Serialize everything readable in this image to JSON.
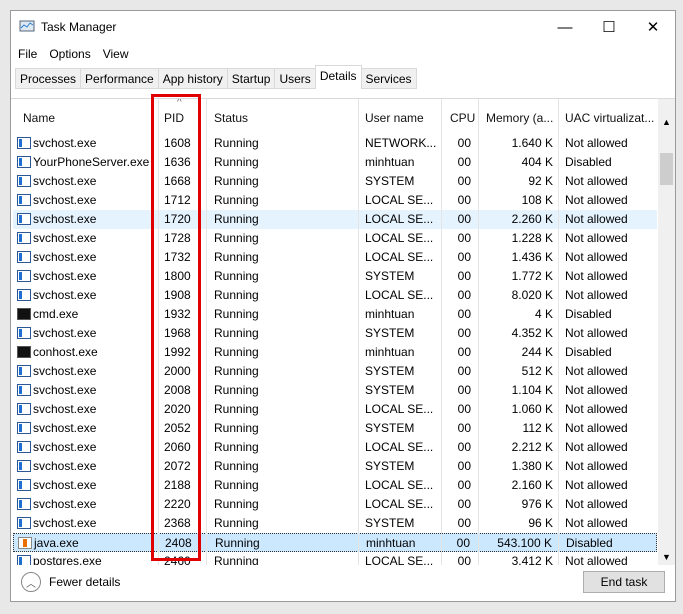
{
  "window": {
    "title": "Task Manager",
    "minimize": "—",
    "maximize": "☐",
    "close": "✕"
  },
  "menu": [
    "File",
    "Options",
    "View"
  ],
  "tabs": [
    "Processes",
    "Performance",
    "App history",
    "Startup",
    "Users",
    "Details",
    "Services"
  ],
  "active_tab": "Details",
  "columns": [
    "Name",
    "PID",
    "Status",
    "User name",
    "CPU",
    "Memory (a...",
    "UAC virtualizat..."
  ],
  "sort_indicator": "^",
  "rows": [
    [
      "svchost.exe",
      "1608",
      "Running",
      "NETWORK...",
      "00",
      "1.640 K",
      "Not allowed",
      "svc"
    ],
    [
      "YourPhoneServer.exe",
      "1636",
      "Running",
      "minhtuan",
      "00",
      "404 K",
      "Disabled",
      "svc"
    ],
    [
      "svchost.exe",
      "1668",
      "Running",
      "SYSTEM",
      "00",
      "92 K",
      "Not allowed",
      "svc"
    ],
    [
      "svchost.exe",
      "1712",
      "Running",
      "LOCAL SE...",
      "00",
      "108 K",
      "Not allowed",
      "svc"
    ],
    [
      "svchost.exe",
      "1720",
      "Running",
      "LOCAL SE...",
      "00",
      "2.260 K",
      "Not allowed",
      "svc"
    ],
    [
      "svchost.exe",
      "1728",
      "Running",
      "LOCAL SE...",
      "00",
      "1.228 K",
      "Not allowed",
      "svc"
    ],
    [
      "svchost.exe",
      "1732",
      "Running",
      "LOCAL SE...",
      "00",
      "1.436 K",
      "Not allowed",
      "svc"
    ],
    [
      "svchost.exe",
      "1800",
      "Running",
      "SYSTEM",
      "00",
      "1.772 K",
      "Not allowed",
      "svc"
    ],
    [
      "svchost.exe",
      "1908",
      "Running",
      "LOCAL SE...",
      "00",
      "8.020 K",
      "Not allowed",
      "svc"
    ],
    [
      "cmd.exe",
      "1932",
      "Running",
      "minhtuan",
      "00",
      "4 K",
      "Disabled",
      "cmd"
    ],
    [
      "svchost.exe",
      "1968",
      "Running",
      "SYSTEM",
      "00",
      "4.352 K",
      "Not allowed",
      "svc"
    ],
    [
      "conhost.exe",
      "1992",
      "Running",
      "minhtuan",
      "00",
      "244 K",
      "Disabled",
      "cmd"
    ],
    [
      "svchost.exe",
      "2000",
      "Running",
      "SYSTEM",
      "00",
      "512 K",
      "Not allowed",
      "svc"
    ],
    [
      "svchost.exe",
      "2008",
      "Running",
      "SYSTEM",
      "00",
      "1.104 K",
      "Not allowed",
      "svc"
    ],
    [
      "svchost.exe",
      "2020",
      "Running",
      "LOCAL SE...",
      "00",
      "1.060 K",
      "Not allowed",
      "svc"
    ],
    [
      "svchost.exe",
      "2052",
      "Running",
      "SYSTEM",
      "00",
      "112 K",
      "Not allowed",
      "svc"
    ],
    [
      "svchost.exe",
      "2060",
      "Running",
      "LOCAL SE...",
      "00",
      "2.212 K",
      "Not allowed",
      "svc"
    ],
    [
      "svchost.exe",
      "2072",
      "Running",
      "SYSTEM",
      "00",
      "1.380 K",
      "Not allowed",
      "svc"
    ],
    [
      "svchost.exe",
      "2188",
      "Running",
      "LOCAL SE...",
      "00",
      "2.160 K",
      "Not allowed",
      "svc"
    ],
    [
      "svchost.exe",
      "2220",
      "Running",
      "LOCAL SE...",
      "00",
      "976 K",
      "Not allowed",
      "svc"
    ],
    [
      "svchost.exe",
      "2368",
      "Running",
      "SYSTEM",
      "00",
      "96 K",
      "Not allowed",
      "svc"
    ],
    [
      "java.exe",
      "2408",
      "Running",
      "minhtuan",
      "00",
      "543.100 K",
      "Disabled",
      "java"
    ],
    [
      "postgres.exe",
      "2460",
      "Running",
      "LOCAL SE...",
      "00",
      "3.412 K",
      "Not allowed",
      "svc"
    ]
  ],
  "hover_row_pid": "1720",
  "selected_row_pid": "2408",
  "footer": {
    "fewer_details": "Fewer details",
    "end_task": "End task"
  },
  "highlight_color": "#e00000"
}
